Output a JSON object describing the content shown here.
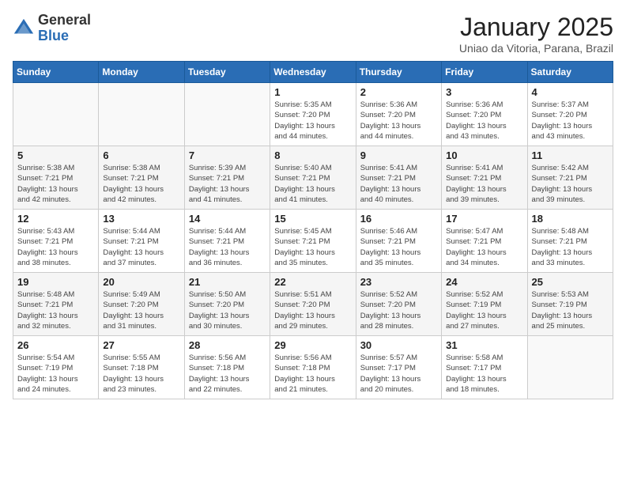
{
  "logo": {
    "general": "General",
    "blue": "Blue"
  },
  "header": {
    "title": "January 2025",
    "subtitle": "Uniao da Vitoria, Parana, Brazil"
  },
  "weekdays": [
    "Sunday",
    "Monday",
    "Tuesday",
    "Wednesday",
    "Thursday",
    "Friday",
    "Saturday"
  ],
  "weeks": [
    [
      {
        "day": "",
        "info": ""
      },
      {
        "day": "",
        "info": ""
      },
      {
        "day": "",
        "info": ""
      },
      {
        "day": "1",
        "info": "Sunrise: 5:35 AM\nSunset: 7:20 PM\nDaylight: 13 hours\nand 44 minutes."
      },
      {
        "day": "2",
        "info": "Sunrise: 5:36 AM\nSunset: 7:20 PM\nDaylight: 13 hours\nand 44 minutes."
      },
      {
        "day": "3",
        "info": "Sunrise: 5:36 AM\nSunset: 7:20 PM\nDaylight: 13 hours\nand 43 minutes."
      },
      {
        "day": "4",
        "info": "Sunrise: 5:37 AM\nSunset: 7:20 PM\nDaylight: 13 hours\nand 43 minutes."
      }
    ],
    [
      {
        "day": "5",
        "info": "Sunrise: 5:38 AM\nSunset: 7:21 PM\nDaylight: 13 hours\nand 42 minutes."
      },
      {
        "day": "6",
        "info": "Sunrise: 5:38 AM\nSunset: 7:21 PM\nDaylight: 13 hours\nand 42 minutes."
      },
      {
        "day": "7",
        "info": "Sunrise: 5:39 AM\nSunset: 7:21 PM\nDaylight: 13 hours\nand 41 minutes."
      },
      {
        "day": "8",
        "info": "Sunrise: 5:40 AM\nSunset: 7:21 PM\nDaylight: 13 hours\nand 41 minutes."
      },
      {
        "day": "9",
        "info": "Sunrise: 5:41 AM\nSunset: 7:21 PM\nDaylight: 13 hours\nand 40 minutes."
      },
      {
        "day": "10",
        "info": "Sunrise: 5:41 AM\nSunset: 7:21 PM\nDaylight: 13 hours\nand 39 minutes."
      },
      {
        "day": "11",
        "info": "Sunrise: 5:42 AM\nSunset: 7:21 PM\nDaylight: 13 hours\nand 39 minutes."
      }
    ],
    [
      {
        "day": "12",
        "info": "Sunrise: 5:43 AM\nSunset: 7:21 PM\nDaylight: 13 hours\nand 38 minutes."
      },
      {
        "day": "13",
        "info": "Sunrise: 5:44 AM\nSunset: 7:21 PM\nDaylight: 13 hours\nand 37 minutes."
      },
      {
        "day": "14",
        "info": "Sunrise: 5:44 AM\nSunset: 7:21 PM\nDaylight: 13 hours\nand 36 minutes."
      },
      {
        "day": "15",
        "info": "Sunrise: 5:45 AM\nSunset: 7:21 PM\nDaylight: 13 hours\nand 35 minutes."
      },
      {
        "day": "16",
        "info": "Sunrise: 5:46 AM\nSunset: 7:21 PM\nDaylight: 13 hours\nand 35 minutes."
      },
      {
        "day": "17",
        "info": "Sunrise: 5:47 AM\nSunset: 7:21 PM\nDaylight: 13 hours\nand 34 minutes."
      },
      {
        "day": "18",
        "info": "Sunrise: 5:48 AM\nSunset: 7:21 PM\nDaylight: 13 hours\nand 33 minutes."
      }
    ],
    [
      {
        "day": "19",
        "info": "Sunrise: 5:48 AM\nSunset: 7:21 PM\nDaylight: 13 hours\nand 32 minutes."
      },
      {
        "day": "20",
        "info": "Sunrise: 5:49 AM\nSunset: 7:20 PM\nDaylight: 13 hours\nand 31 minutes."
      },
      {
        "day": "21",
        "info": "Sunrise: 5:50 AM\nSunset: 7:20 PM\nDaylight: 13 hours\nand 30 minutes."
      },
      {
        "day": "22",
        "info": "Sunrise: 5:51 AM\nSunset: 7:20 PM\nDaylight: 13 hours\nand 29 minutes."
      },
      {
        "day": "23",
        "info": "Sunrise: 5:52 AM\nSunset: 7:20 PM\nDaylight: 13 hours\nand 28 minutes."
      },
      {
        "day": "24",
        "info": "Sunrise: 5:52 AM\nSunset: 7:19 PM\nDaylight: 13 hours\nand 27 minutes."
      },
      {
        "day": "25",
        "info": "Sunrise: 5:53 AM\nSunset: 7:19 PM\nDaylight: 13 hours\nand 25 minutes."
      }
    ],
    [
      {
        "day": "26",
        "info": "Sunrise: 5:54 AM\nSunset: 7:19 PM\nDaylight: 13 hours\nand 24 minutes."
      },
      {
        "day": "27",
        "info": "Sunrise: 5:55 AM\nSunset: 7:18 PM\nDaylight: 13 hours\nand 23 minutes."
      },
      {
        "day": "28",
        "info": "Sunrise: 5:56 AM\nSunset: 7:18 PM\nDaylight: 13 hours\nand 22 minutes."
      },
      {
        "day": "29",
        "info": "Sunrise: 5:56 AM\nSunset: 7:18 PM\nDaylight: 13 hours\nand 21 minutes."
      },
      {
        "day": "30",
        "info": "Sunrise: 5:57 AM\nSunset: 7:17 PM\nDaylight: 13 hours\nand 20 minutes."
      },
      {
        "day": "31",
        "info": "Sunrise: 5:58 AM\nSunset: 7:17 PM\nDaylight: 13 hours\nand 18 minutes."
      },
      {
        "day": "",
        "info": ""
      }
    ]
  ]
}
